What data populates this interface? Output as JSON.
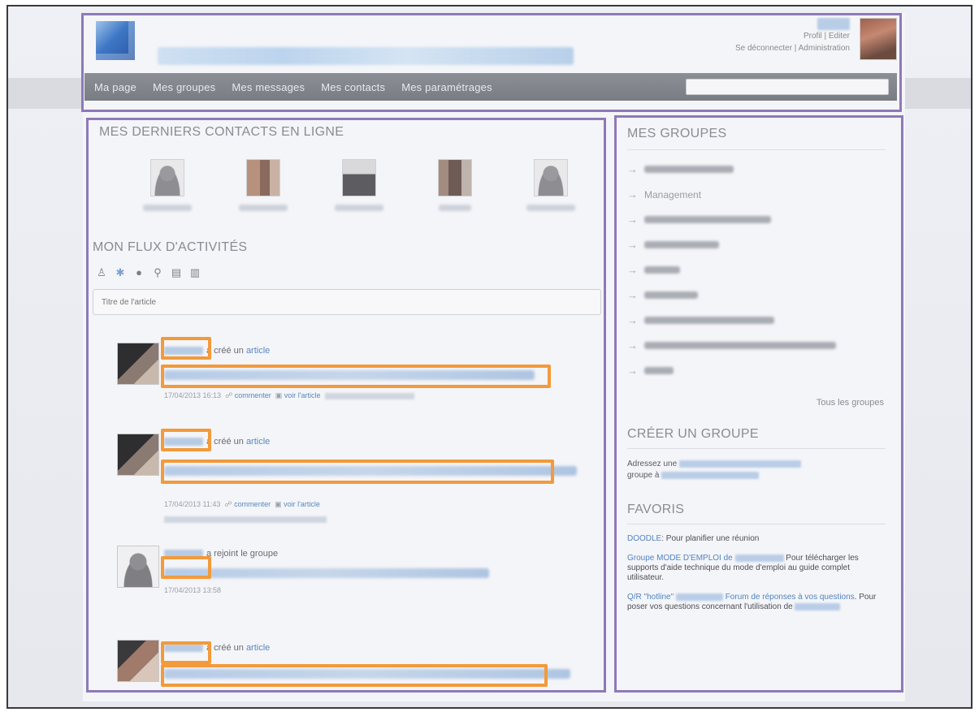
{
  "header": {
    "links_line2": "Profil | Editer",
    "links_line3": "Se déconnecter | Administration"
  },
  "nav": {
    "items": [
      "Ma page",
      "Mes groupes",
      "Mes messages",
      "Mes contacts",
      "Mes paramétrages"
    ]
  },
  "contacts": {
    "title": "MES DERNIERS CONTACTS EN LIGNE"
  },
  "activity": {
    "title": "MON FLUX D'ACTIVITÉS",
    "toolbar_icons": [
      "person-icon",
      "star-icon",
      "globe-icon",
      "link-icon",
      "list-icon",
      "grid-icon"
    ],
    "input_placeholder": "Titre de l'article",
    "items": [
      {
        "action": "a créé un",
        "object": "article",
        "date": "17/04/2013 16:13",
        "comment": "commenter",
        "view": "voir l'article"
      },
      {
        "action": "a créé un",
        "object": "article",
        "date": "17/04/2013 11:43",
        "comment": "commenter",
        "view": "voir l'article"
      },
      {
        "action": "a rejoint le groupe",
        "date": "17/04/2013 13:58"
      },
      {
        "action": "a créé un",
        "object": "article"
      }
    ]
  },
  "groups": {
    "title": "MES GROUPES",
    "items": [
      "Management"
    ],
    "all_link": "Tous les groupes"
  },
  "create": {
    "title": "CRÉER UN GROUPE",
    "text_before": "Adressez une",
    "text_middle": "groupe à"
  },
  "favorites": {
    "title": "FAVORIS",
    "doodle_link": "DOODLE",
    "doodle_text": ": Pour planifier une réunion",
    "mode_link": "Groupe MODE D'EMPLOI de",
    "mode_text": "Pour télécharger les supports d'aide technique du mode d'emploi au guide complet utilisateur.",
    "hotline_link": "Q/R \"hotline\"",
    "hotline_link2": "Forum de réponses à vos questions",
    "hotline_text": ". Pour poser vos questions concernant l'utilisation de"
  },
  "colors": {
    "annotation_purple": "#8e79b8",
    "annotation_orange": "#f29a3c",
    "link_blue": "#4f83c4",
    "navbar_gray": "#7f828a"
  }
}
